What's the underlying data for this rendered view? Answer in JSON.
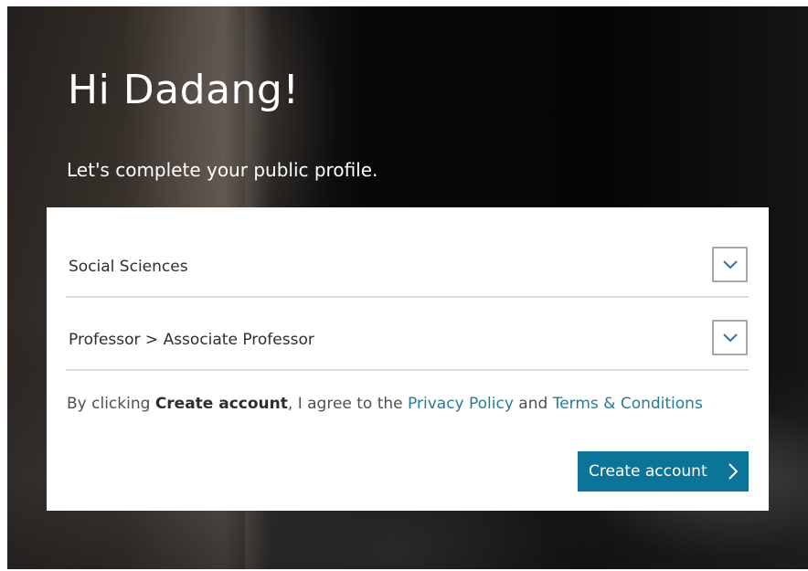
{
  "header": {
    "greeting": "Hi Dadang!",
    "subtitle": "Let's complete your public profile."
  },
  "form": {
    "subject_area": {
      "value": "Social Sciences",
      "icon": "chevron-down-icon"
    },
    "position": {
      "value": "Professor > Associate Professor",
      "icon": "chevron-down-icon"
    },
    "agreement": {
      "prefix": "By clicking ",
      "bold": "Create account",
      "middle": ", I agree to the ",
      "privacy_link": "Privacy Policy",
      "and": " and ",
      "terms_link": "Terms & Conditions"
    },
    "submit_label": "Create account",
    "submit_icon": "chevron-right-icon"
  },
  "colors": {
    "accent": "#0c7499",
    "link": "#2a7a95",
    "chevron": "#2a7a95",
    "text": "#2e2e2e",
    "border": "#dcdcdc"
  }
}
